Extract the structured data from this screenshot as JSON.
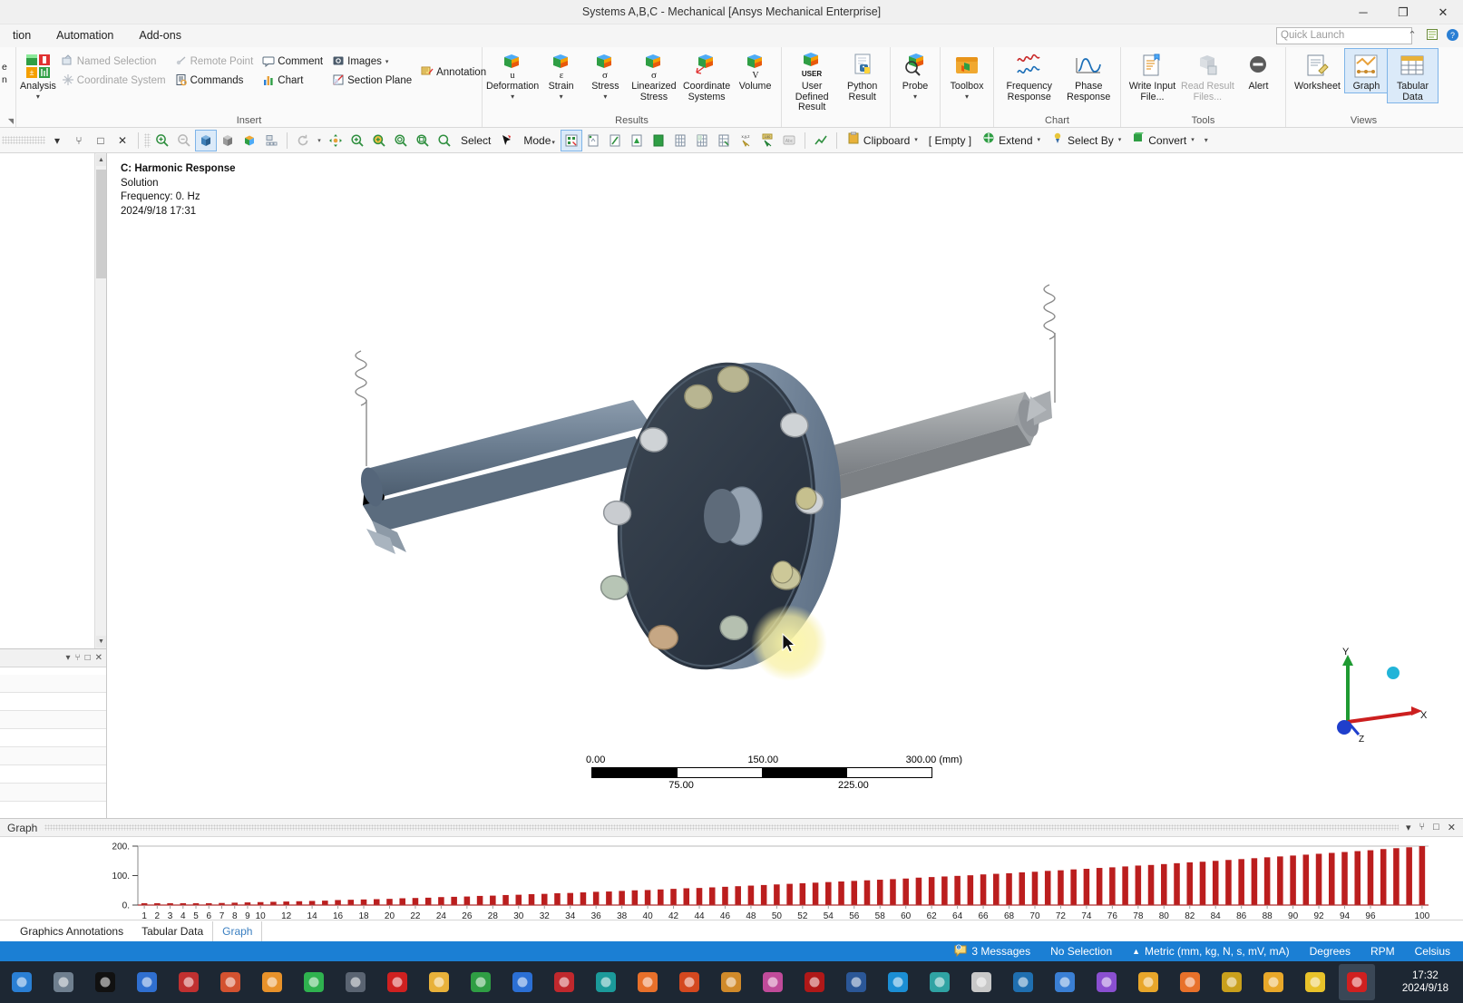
{
  "window": {
    "title": "Systems A,B,C - Mechanical [Ansys Mechanical Enterprise]",
    "minimize": "─",
    "restore": "❐",
    "close": "✕"
  },
  "menubar": {
    "items": [
      "tion",
      "Automation",
      "Add-ons"
    ],
    "quick_launch_placeholder": "Quick Launch",
    "chevron": "⌃",
    "help": "?"
  },
  "ribbon": {
    "groups": [
      {
        "name": "Insert",
        "label": "Insert",
        "big_buttons": [
          {
            "label": "Analysis",
            "icon": "analysis-icon",
            "caret": "▾"
          }
        ],
        "small_buttons": [
          {
            "label": "Named Selection",
            "icon": "named-selection-icon",
            "disabled": true
          },
          {
            "label": "Coordinate System",
            "icon": "coordinate-system-icon",
            "disabled": true
          },
          {
            "label": "Remote Point",
            "icon": "remote-point-icon",
            "disabled": true
          },
          {
            "label": "Commands",
            "icon": "commands-icon",
            "disabled": false
          },
          {
            "label": "Comment",
            "icon": "comment-icon",
            "disabled": false
          },
          {
            "label": "Chart",
            "icon": "chart-icon",
            "disabled": false
          },
          {
            "label": "Images",
            "icon": "images-icon",
            "disabled": false,
            "caret": "▾"
          },
          {
            "label": "Section Plane",
            "icon": "section-plane-icon",
            "disabled": false
          },
          {
            "label": "Annotation",
            "icon": "annotation-icon",
            "disabled": false
          }
        ]
      },
      {
        "name": "Results",
        "label": "Results",
        "big_buttons": [
          {
            "label": "Deformation",
            "icon": "deformation-icon",
            "glyph": "u",
            "caret": "▾"
          },
          {
            "label": "Strain",
            "icon": "strain-icon",
            "glyph": "ε",
            "caret": "▾"
          },
          {
            "label": "Stress",
            "icon": "stress-icon",
            "glyph": "σ",
            "caret": "▾"
          },
          {
            "label": "Linearized Stress",
            "icon": "linearized-stress-icon",
            "glyph": "σ",
            "caret": "▾"
          },
          {
            "label": "Coordinate Systems",
            "icon": "coordinate-systems-icon",
            "caret": "▾"
          },
          {
            "label": "Volume",
            "icon": "volume-icon",
            "glyph": "V"
          }
        ]
      },
      {
        "name": "UserDefined",
        "label": "",
        "big_buttons": [
          {
            "label": "User Defined Result",
            "icon": "user-defined-result-icon",
            "glyph": "USER"
          },
          {
            "label": "Python Result",
            "icon": "python-result-icon"
          }
        ]
      },
      {
        "name": "ProbeGroup",
        "label": "",
        "big_buttons": [
          {
            "label": "Probe",
            "icon": "probe-icon",
            "caret": "▾"
          }
        ]
      },
      {
        "name": "ToolboxGroup",
        "label": "",
        "big_buttons": [
          {
            "label": "Toolbox",
            "icon": "toolbox-icon",
            "caret": "▾"
          }
        ]
      },
      {
        "name": "Chart",
        "label": "Chart",
        "big_buttons": [
          {
            "label": "Frequency Response",
            "icon": "frequency-response-icon",
            "caret": "▾"
          },
          {
            "label": "Phase Response",
            "icon": "phase-response-icon",
            "caret": "▾"
          }
        ]
      },
      {
        "name": "Tools",
        "label": "Tools",
        "big_buttons": [
          {
            "label": "Write Input File...",
            "icon": "write-input-file-icon"
          },
          {
            "label": "Read Result Files...",
            "icon": "read-result-files-icon",
            "disabled": true
          },
          {
            "label": "Alert",
            "icon": "alert-icon"
          }
        ]
      },
      {
        "name": "Views",
        "label": "Views",
        "big_buttons": [
          {
            "label": "Worksheet",
            "icon": "worksheet-icon"
          },
          {
            "label": "Graph",
            "icon": "graph-icon",
            "selected": true
          },
          {
            "label": "Tabular Data",
            "icon": "tabular-data-icon",
            "selected": true
          }
        ]
      }
    ]
  },
  "view_toolbar": {
    "panel_controls": [
      "▾",
      "⑂",
      "□",
      "✕"
    ],
    "select_label": "Select",
    "mode_label": "Mode",
    "mode_caret": "▾",
    "clipboard_label": "Clipboard",
    "empty_label": "[ Empty ]",
    "extend_label": "Extend",
    "select_by_label": "Select By",
    "convert_label": "Convert",
    "caret": "▾"
  },
  "viewport": {
    "legend": {
      "line1": "C: Harmonic Response",
      "line2": "Solution",
      "line3": "Frequency: 0. Hz",
      "line4": "2024/9/18 17:31"
    },
    "scale_bar": {
      "top_labels": [
        "0.00",
        "150.00",
        "300.00 (mm)"
      ],
      "bottom_labels": [
        "75.00",
        "225.00"
      ]
    },
    "triad": {
      "x": "X",
      "y": "Y",
      "z": "Z"
    }
  },
  "graph_panel": {
    "title": "Graph",
    "header_buttons": [
      "▾",
      "⑂",
      "□",
      "✕"
    ],
    "tabs": [
      {
        "label": "Graphics Annotations",
        "active": false
      },
      {
        "label": "Tabular Data",
        "active": false
      },
      {
        "label": "Graph",
        "active": true
      }
    ]
  },
  "chart_data": {
    "type": "bar",
    "title": "Graph",
    "xlabel": "",
    "ylabel": "",
    "grid": false,
    "legend": "none",
    "ylim": [
      0,
      200
    ],
    "yticks": [
      0,
      100,
      200
    ],
    "ytick_labels": [
      "0.",
      "100.",
      "200."
    ],
    "xlim": [
      1,
      100
    ],
    "xtick_labels": [
      "1",
      "2",
      "3",
      "4",
      "5",
      "6",
      "7",
      "8",
      "9",
      "10",
      "12",
      "14",
      "16",
      "18",
      "20",
      "22",
      "24",
      "26",
      "28",
      "30",
      "32",
      "34",
      "36",
      "38",
      "40",
      "42",
      "44",
      "46",
      "48",
      "50",
      "52",
      "54",
      "56",
      "58",
      "60",
      "62",
      "64",
      "66",
      "68",
      "70",
      "72",
      "74",
      "76",
      "78",
      "80",
      "82",
      "84",
      "86",
      "88",
      "90",
      "92",
      "94",
      "96",
      "100"
    ],
    "xticks": [
      1,
      2,
      3,
      4,
      5,
      6,
      7,
      8,
      9,
      10,
      12,
      14,
      16,
      18,
      20,
      22,
      24,
      26,
      28,
      30,
      32,
      34,
      36,
      38,
      40,
      42,
      44,
      46,
      48,
      50,
      52,
      54,
      56,
      58,
      60,
      62,
      64,
      66,
      68,
      70,
      72,
      74,
      76,
      78,
      80,
      82,
      84,
      86,
      88,
      90,
      92,
      94,
      96,
      100
    ],
    "series_color": "#bb1e1e",
    "categories": [
      1,
      2,
      3,
      4,
      5,
      6,
      7,
      8,
      9,
      10,
      11,
      12,
      13,
      14,
      15,
      16,
      17,
      18,
      19,
      20,
      21,
      22,
      23,
      24,
      25,
      26,
      27,
      28,
      29,
      30,
      31,
      32,
      33,
      34,
      35,
      36,
      37,
      38,
      39,
      40,
      41,
      42,
      43,
      44,
      45,
      46,
      47,
      48,
      49,
      50,
      51,
      52,
      53,
      54,
      55,
      56,
      57,
      58,
      59,
      60,
      61,
      62,
      63,
      64,
      65,
      66,
      67,
      68,
      69,
      70,
      71,
      72,
      73,
      74,
      75,
      76,
      77,
      78,
      79,
      80,
      81,
      82,
      83,
      84,
      85,
      86,
      87,
      88,
      89,
      90,
      91,
      92,
      93,
      94,
      95,
      96,
      97,
      98,
      99,
      100
    ],
    "values": [
      2,
      2,
      3,
      4,
      5,
      6,
      7,
      8,
      9,
      10,
      11,
      12,
      13,
      14,
      15,
      17,
      18,
      19,
      20,
      21,
      23,
      24,
      25,
      27,
      28,
      29,
      31,
      32,
      34,
      35,
      37,
      38,
      40,
      41,
      43,
      45,
      46,
      48,
      50,
      51,
      53,
      55,
      57,
      58,
      60,
      62,
      64,
      66,
      68,
      70,
      72,
      74,
      76,
      78,
      80,
      82,
      84,
      86,
      88,
      90,
      93,
      95,
      97,
      99,
      101,
      104,
      106,
      108,
      111,
      113,
      116,
      118,
      121,
      123,
      126,
      128,
      131,
      134,
      136,
      139,
      142,
      145,
      147,
      150,
      153,
      156,
      159,
      162,
      165,
      168,
      171,
      174,
      177,
      180,
      183,
      186,
      190,
      193,
      196,
      200
    ]
  },
  "status_bar": {
    "messages": "3 Messages",
    "selection": "No Selection",
    "units": "Metric (mm, kg, N, s, mV, mA)",
    "angle": "Degrees",
    "rotation": "RPM",
    "temperature": "Celsius",
    "units_caret": "▲"
  },
  "taskbar": {
    "icons": [
      "start-icon",
      "task-view-icon",
      "lsp-icon",
      "app-blue-icon",
      "er-icon",
      "powerpoint-icon",
      "vm-icon",
      "wechat-icon",
      "unity-icon",
      "record-icon",
      "colors-icon",
      "d-app-icon",
      "x-app-icon",
      "solidworks-icon",
      "cad-icon",
      "telegram-icon",
      "matlab-icon",
      "chart-app-icon",
      "diamond-icon",
      "w-red-icon",
      "word-icon",
      "edge-icon",
      "shield-icon",
      "gif-icon",
      "pc-icon",
      "blue-icon",
      "premiere-icon",
      "wb-icon",
      "ai-icon",
      "a-icon",
      "wb2-icon",
      "m-icon",
      "record2-icon"
    ],
    "clock_time": "17:32",
    "clock_date": "2024/9/18"
  }
}
